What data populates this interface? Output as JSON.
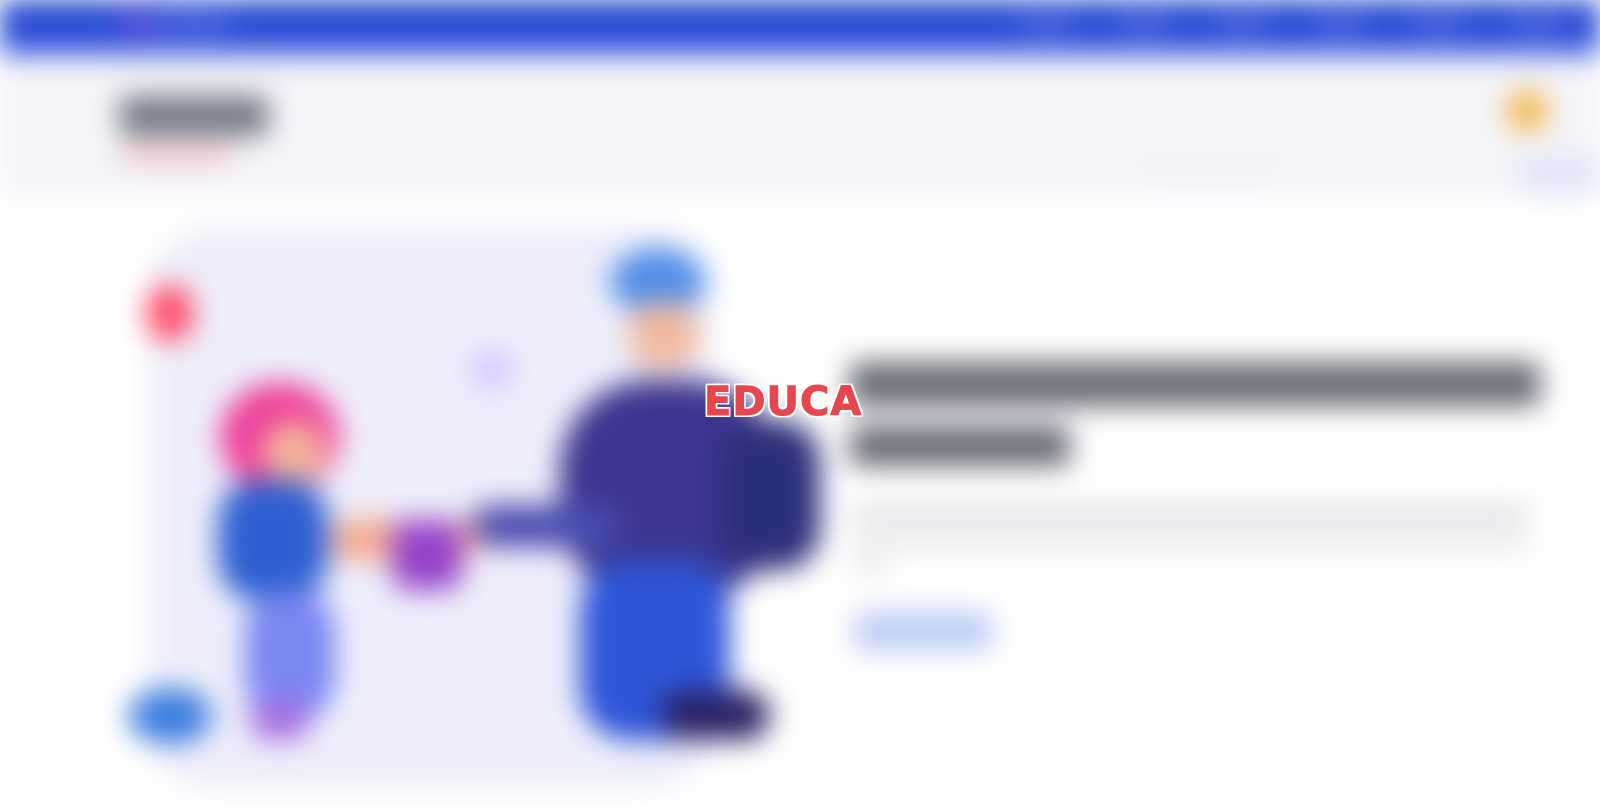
{
  "hero": {
    "brand_text": "EDUCA"
  },
  "colors": {
    "topbar": "#2146cf",
    "navbar": "#f5f5fa",
    "hero_panel": "#eeeefb",
    "brand_text": "#e8464d",
    "cart_accent": "#f3b54a",
    "cta_button": "#b7c6f4"
  },
  "icons": {
    "cart": "shopping-cart-icon"
  }
}
